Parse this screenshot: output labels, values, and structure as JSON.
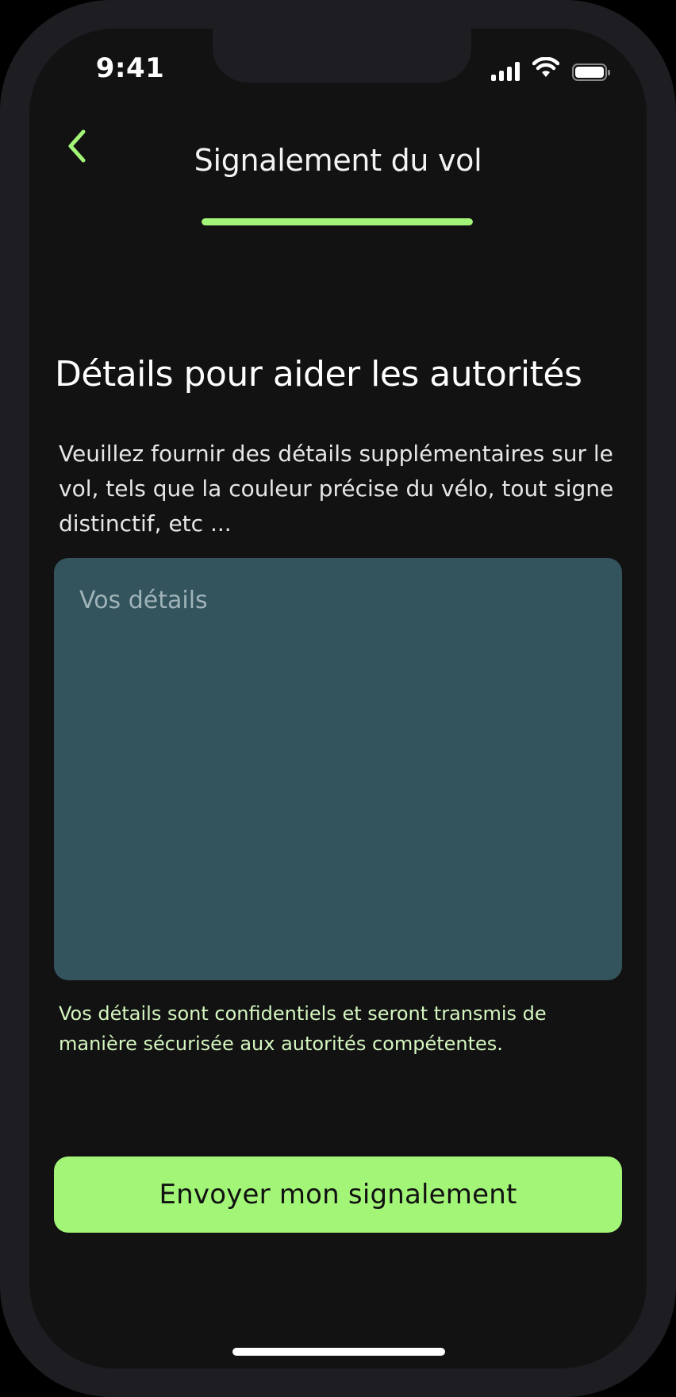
{
  "status_bar": {
    "time": "9:41",
    "icons": [
      "cellular-signal-icon",
      "wifi-icon",
      "battery-icon"
    ]
  },
  "header": {
    "back_icon": "chevron-left-icon",
    "title": "Signalement du vol",
    "progress": 1.0
  },
  "main": {
    "section_title": "Détails pour aider les autorités",
    "description": "Veuillez fournir des détails supplémentaires sur le vol, tels que la couleur précise du vélo, tout signe distinctif, etc ...",
    "details_field": {
      "placeholder": "Vos détails",
      "value": ""
    },
    "confidential_note": "Vos détails sont confidentiels et seront transmis de manière sécurisée aux autorités compétentes.",
    "submit_label": "Envoyer mon signalement"
  },
  "colors": {
    "background": "#121212",
    "accent": "#a2f577",
    "input_background": "#33535d",
    "note_text": "#d5f7c0"
  }
}
